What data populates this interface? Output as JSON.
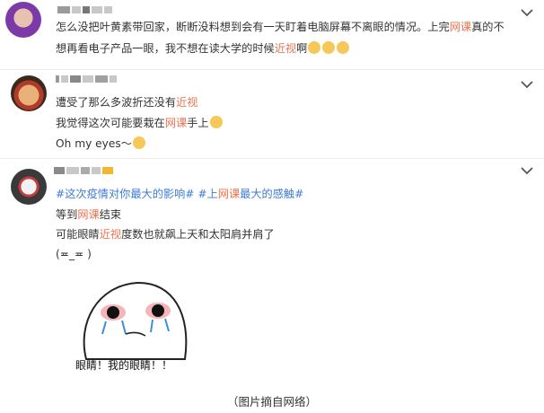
{
  "posts": [
    {
      "lines": [
        {
          "segments": [
            {
              "text": "怎么没把叶黄素带回家，断断没料想到会有一天盯着电脑屏幕不离眼的情况。上完"
            },
            {
              "text": "网课",
              "hl": true
            },
            {
              "text": "真的不"
            }
          ]
        },
        {
          "segments": [
            {
              "text": "想再看电子产品一眼，我不想在读大学的时候"
            },
            {
              "text": "近视",
              "hl": true
            },
            {
              "text": "啊"
            }
          ],
          "emojis": 3
        }
      ]
    },
    {
      "lines": [
        {
          "segments": [
            {
              "text": "遭受了那么多波折还没有"
            },
            {
              "text": "近视",
              "hl": true
            }
          ]
        },
        {
          "segments": [
            {
              "text": "我觉得这次可能要栽在"
            },
            {
              "text": "网课",
              "hl": true
            },
            {
              "text": "手上"
            }
          ],
          "emojis": 1
        },
        {
          "segments": [
            {
              "text": "Oh my eyes～"
            }
          ],
          "emojis": 1
        }
      ]
    },
    {
      "lines": [
        {
          "segments": [
            {
              "text": "#这次疫情对你最大的影响# #上",
              "tag": true
            },
            {
              "text": "网课",
              "hl": true
            },
            {
              "text": "最大的感触#",
              "tag": true
            }
          ]
        },
        {
          "segments": [
            {
              "text": "等到"
            },
            {
              "text": "网课",
              "hl": true
            },
            {
              "text": "结束"
            }
          ]
        },
        {
          "segments": [
            {
              "text": "可能眼睛"
            },
            {
              "text": "近视",
              "hl": true
            },
            {
              "text": "度数也就飙上天和太阳肩并肩了"
            }
          ]
        },
        {
          "segments": [
            {
              "text": "(≖_≖ )"
            }
          ]
        }
      ],
      "meme_text": "眼睛！我的眼睛！！"
    }
  ],
  "caption": "（图片摘自网络）",
  "colors": {
    "highlight": "#eb7350",
    "hashtag": "#3d7bd6",
    "divider": "#ececec"
  },
  "icons": [
    "avatar",
    "chevron-down-icon",
    "crying-face-emoji",
    "teary-face-emoji",
    "crying-cartoon-face"
  ]
}
